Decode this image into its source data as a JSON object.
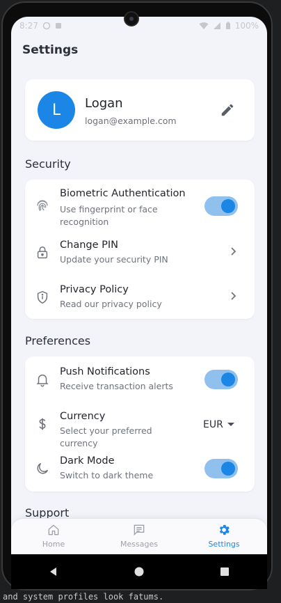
{
  "colors": {
    "accent": "#1c86e6",
    "toggle_track": "#8fc0ee",
    "background": "#f3f4f9"
  },
  "status_bar": {
    "time": "8:27",
    "battery": "100%"
  },
  "page": {
    "title": "Settings"
  },
  "profile": {
    "initial": "L",
    "name": "Logan",
    "email": "logan@example.com",
    "edit_icon": "pencil-icon"
  },
  "security": {
    "title": "Security",
    "items": [
      {
        "title": "Biometric Authentication",
        "subtitle": "Use fingerprint or face recognition",
        "icon": "fingerprint-icon",
        "control": "toggle",
        "on": true
      },
      {
        "title": "Change PIN",
        "subtitle": "Update your security PIN",
        "icon": "lock-icon",
        "control": "chevron"
      },
      {
        "title": "Privacy Policy",
        "subtitle": "Read our privacy policy",
        "icon": "shield-icon",
        "control": "chevron"
      }
    ]
  },
  "preferences": {
    "title": "Preferences",
    "items": [
      {
        "title": "Push Notifications",
        "subtitle": "Receive transaction alerts",
        "icon": "bell-icon",
        "control": "toggle",
        "on": true
      },
      {
        "title": "Currency",
        "subtitle": "Select your preferred currency",
        "icon": "dollar-icon",
        "control": "select",
        "value": "EUR"
      },
      {
        "title": "Dark Mode",
        "subtitle": "Switch to dark theme",
        "icon": "moon-icon",
        "control": "toggle",
        "on": true
      }
    ]
  },
  "support": {
    "title": "Support"
  },
  "bottom_nav": {
    "items": [
      {
        "label": "Home",
        "icon": "home-icon",
        "active": false
      },
      {
        "label": "Messages",
        "icon": "message-icon",
        "active": false
      },
      {
        "label": "Settings",
        "icon": "gear-icon",
        "active": true
      }
    ]
  },
  "system_nav": {
    "buttons": [
      "back-icon",
      "home-circle-icon",
      "recents-icon"
    ]
  },
  "terminal": {
    "text": "and system profiles look fatums."
  }
}
